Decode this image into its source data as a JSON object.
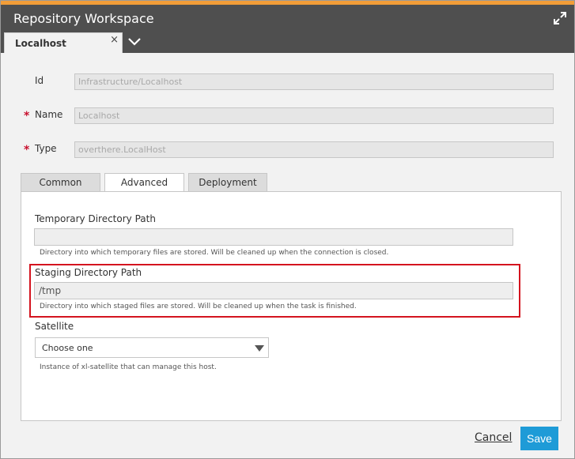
{
  "window": {
    "title": "Repository Workspace",
    "accent_color": "#f29d38",
    "expand_icon": "expand-arrows-icon"
  },
  "document_tabs": [
    {
      "label": "Localhost",
      "close": "×"
    }
  ],
  "fields": {
    "id": {
      "label": "Id",
      "value": "Infrastructure/Localhost",
      "required": false
    },
    "name": {
      "label": "Name",
      "value": "Localhost",
      "required": true
    },
    "type": {
      "label": "Type",
      "value": "overthere.LocalHost",
      "required": true
    },
    "required_marker": "*"
  },
  "inner_tabs": [
    {
      "label": "Common",
      "active": false
    },
    {
      "label": "Advanced",
      "active": true
    },
    {
      "label": "Deployment",
      "active": false
    }
  ],
  "advanced": {
    "temp_dir": {
      "label": "Temporary Directory Path",
      "value": "",
      "hint": "Directory into which temporary files are stored. Will be cleaned up when the connection is closed."
    },
    "staging_dir": {
      "label": "Staging Directory Path",
      "value": "/tmp",
      "hint": "Directory into which staged files are stored. Will be cleaned up when the task is finished."
    },
    "satellite": {
      "label": "Satellite",
      "selected": "Choose one",
      "hint": "Instance of xl-satellite that can manage this host."
    }
  },
  "footer": {
    "cancel_label": "Cancel",
    "save_label": "Save",
    "save_color": "#1e9bd7"
  },
  "highlight_color": "#d4141f"
}
